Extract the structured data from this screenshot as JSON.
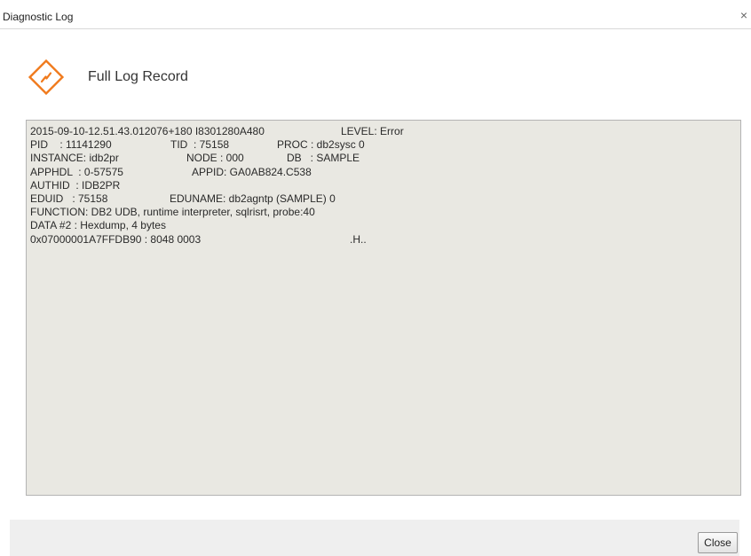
{
  "window": {
    "title": "Diagnostic Log",
    "close_glyph": "×",
    "close_icon": "close-icon"
  },
  "header": {
    "icon": "warning-diamond-icon",
    "icon_color": "#f07a1c",
    "heading": "Full Log Record"
  },
  "log": {
    "background": "#e9e8e2",
    "lines": [
      {
        "c1": "2015-09-10-12.51.43.012076+180 I8301280A480",
        "c2": "",
        "c3": "LEVEL: Error"
      },
      {
        "c1": "PID    : 11141290",
        "c2": "TID  : 75158",
        "c3": "PROC : db2sysc 0"
      },
      {
        "c1": "INSTANCE: idb2pr",
        "c2": "NODE : 000",
        "c3": "DB   : SAMPLE"
      },
      {
        "c1": "APPHDL  : 0-57575",
        "c2": "APPID: GA0AB824.C538",
        "c3": ""
      },
      {
        "c1": "AUTHID  : IDB2PR",
        "c2": "",
        "c3": ""
      },
      {
        "c1": "EDUID   : 75158",
        "c2": "EDUNAME: db2agntp (SAMPLE) 0",
        "c3": ""
      },
      {
        "c1": "FUNCTION: DB2 UDB, runtime interpreter, sqlrisrt, probe:40",
        "c2": "",
        "c3": ""
      },
      {
        "c1": "DATA #2 : Hexdump, 4 bytes",
        "c2": "",
        "c3": ""
      },
      {
        "c1": "0x07000001A7FFDB90 : 8048 0003",
        "c2": "",
        "c3": ".H.."
      }
    ]
  },
  "footer": {
    "close_label": "Close"
  }
}
